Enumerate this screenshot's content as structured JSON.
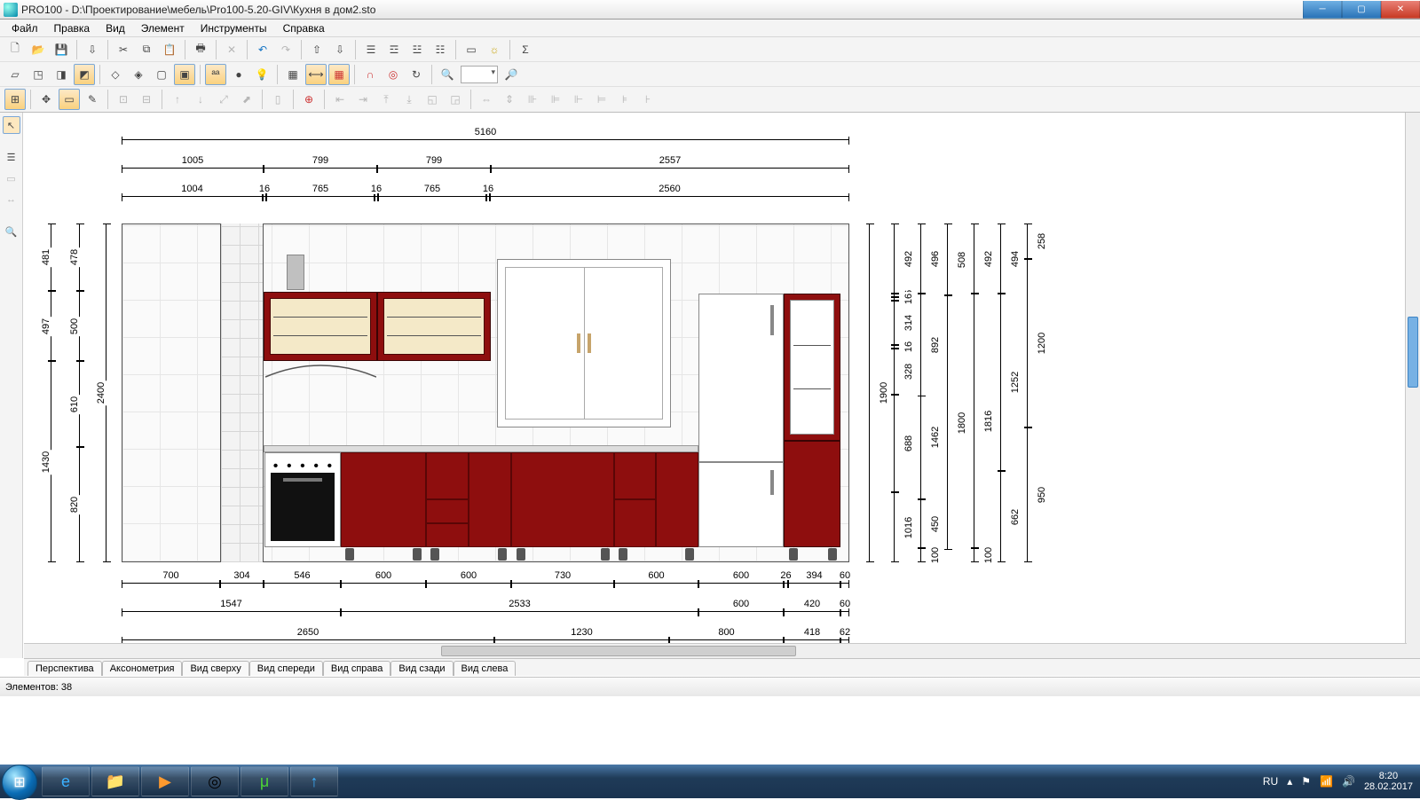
{
  "titlebar": {
    "text": "PRO100 - D:\\Проектирование\\мебель\\Pro100-5.20-GIV\\Кухня в дом2.sto"
  },
  "menu": [
    "Файл",
    "Правка",
    "Вид",
    "Элемент",
    "Инструменты",
    "Справка"
  ],
  "view_tabs": [
    "Перспектива",
    "Аксонометрия",
    "Вид сверху",
    "Вид спереди",
    "Вид справа",
    "Вид сзади",
    "Вид слева"
  ],
  "status": {
    "elements": "Элементов: 38"
  },
  "systray": {
    "lang": "RU",
    "time": "8:20",
    "date": "28.02.2017"
  },
  "dims": {
    "top_total": "5160",
    "top_r2": [
      "1005",
      "799",
      "799",
      "2557"
    ],
    "top_r3": [
      "1004",
      "16",
      "765",
      "16",
      "765",
      "16",
      "2560"
    ],
    "bottom_r1": [
      "700",
      "304",
      "546",
      "600",
      "600",
      "730",
      "600",
      "600",
      "26",
      "394",
      "60"
    ],
    "bottom_r2": [
      "1547",
      "2533",
      "600",
      "420",
      "60"
    ],
    "bottom_r3": [
      "2650",
      "1230",
      "800",
      "418",
      "62"
    ],
    "left_inner": [
      "478",
      "500",
      "610",
      "820"
    ],
    "left_mid": [
      "481",
      "497",
      "1430"
    ],
    "left_outer": "2400",
    "right_c1": [
      "492",
      "16",
      "16",
      "314",
      "16",
      "328",
      "688",
      "1016"
    ],
    "right_c2": [
      "496",
      "892",
      "1462",
      "450",
      "100"
    ],
    "right_c3": [
      "508",
      "1800"
    ],
    "right_c4": [
      "492",
      "1816",
      "100"
    ],
    "right_c5": [
      "494",
      "1252",
      "662"
    ],
    "right_c6": [
      "258",
      "1200",
      "950"
    ],
    "right_outer": "1900"
  }
}
